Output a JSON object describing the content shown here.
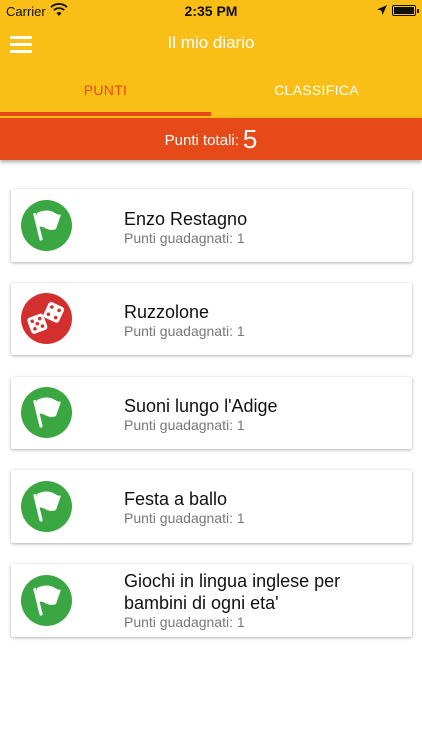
{
  "status_bar": {
    "carrier": "Carrier",
    "time": "2:35 PM"
  },
  "header": {
    "title": "Il mio diario"
  },
  "tabs": [
    {
      "label": "PUNTI",
      "active": true
    },
    {
      "label": "CLASSIFICA",
      "active": false
    }
  ],
  "total": {
    "label": "Punti totali:",
    "value": "5"
  },
  "entries": [
    {
      "name": "Enzo Restagno",
      "points": "Punti guadagnati: 1",
      "icon": "flag-icon",
      "color": "#3aa742"
    },
    {
      "name": "Ruzzolone",
      "points": "Punti guadagnati: 1",
      "icon": "dice-icon",
      "color": "#d32f2f"
    },
    {
      "name": "Suoni lungo l'Adige",
      "points": "Punti guadagnati: 1",
      "icon": "flag-icon",
      "color": "#3aa742"
    },
    {
      "name": "Festa a ballo",
      "points": "Punti guadagnati: 1",
      "icon": "flag-icon",
      "color": "#3aa742"
    },
    {
      "name": "Giochi in lingua inglese per bambini di ogni eta'",
      "points": "Punti guadagnati: 1",
      "icon": "flag-icon",
      "color": "#3aa742"
    }
  ],
  "colors": {
    "header": "#f9bf17",
    "accent": "#e64a19"
  }
}
